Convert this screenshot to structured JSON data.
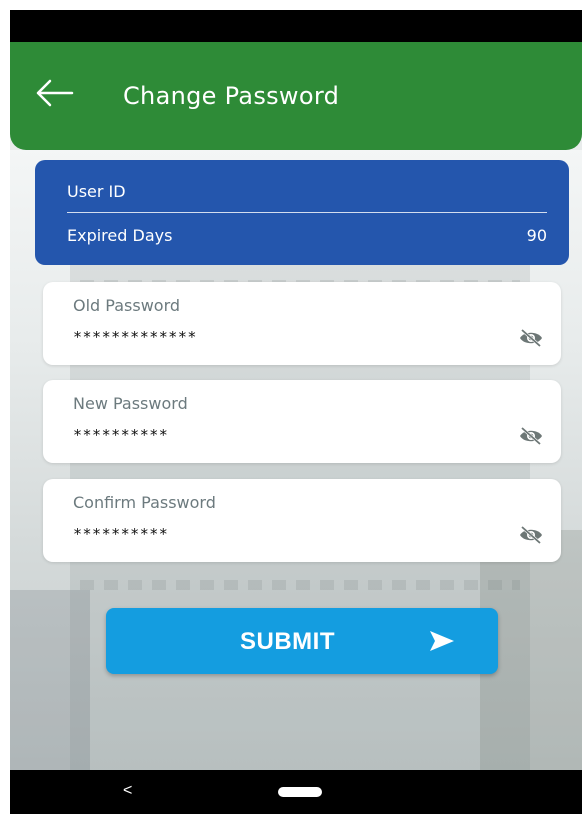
{
  "app_bar": {
    "title": "Change Password",
    "back_icon": "arrow-left-icon",
    "color": "#2e8b37"
  },
  "info_card": {
    "user_id_label": "User ID",
    "user_id_value": "",
    "expired_days_label": "Expired Days",
    "expired_days_value": "90",
    "color": "#2456ad"
  },
  "fields": [
    {
      "label": "Old Password",
      "value": "*************",
      "icon": "eye-off-icon"
    },
    {
      "label": "New Password",
      "value": "**********",
      "icon": "eye-off-icon"
    },
    {
      "label": "Confirm Password",
      "value": "**********",
      "icon": "eye-off-icon"
    }
  ],
  "submit": {
    "label": "SUBMIT",
    "icon": "send-arrow-icon",
    "color": "#149de0"
  },
  "nav_bar": {
    "back_glyph": "<",
    "home_icon": "home-pill-icon"
  }
}
